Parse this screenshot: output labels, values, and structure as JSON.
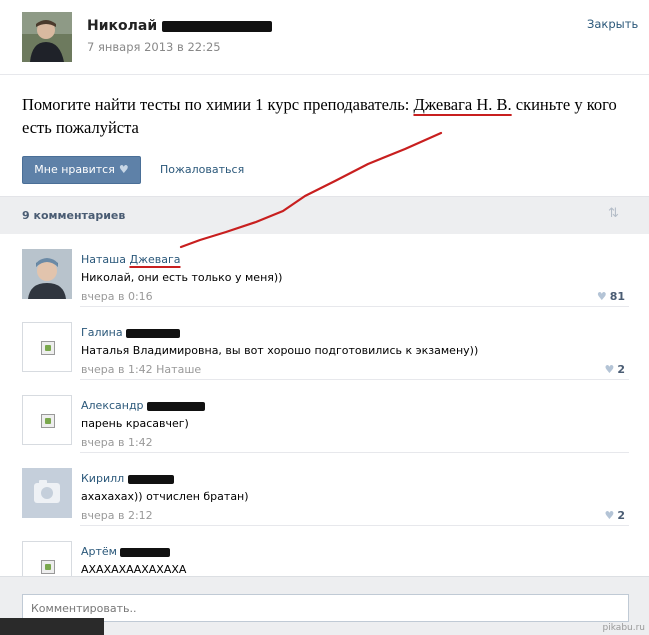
{
  "post": {
    "author_first_name": "Николай",
    "date": "7 января 2013 в 22:25",
    "close_label": "Закрыть",
    "text_before": "Помогите найти тесты по химии 1 курс преподаватель: ",
    "text_highlight": "Джевага Н. В.",
    "text_after": " скиньте у кого есть пожалуйста",
    "like_label": "Мне нравится",
    "report_label": "Пожаловаться"
  },
  "comments_header": {
    "count_label": "9 комментариев"
  },
  "comments": [
    {
      "first_name": "Наташа",
      "surname": "Джевага",
      "text": "Николай, они есть только у меня))",
      "time": "вчера в 0:16",
      "reply_to": "",
      "likes": "81"
    },
    {
      "first_name": "Галина",
      "surname": "",
      "text": "Наталья Владимировна, вы вот хорошо подготовились к экзамену))",
      "time": "вчера в 1:42",
      "reply_to": "Наташе",
      "likes": "2"
    },
    {
      "first_name": "Александр",
      "surname": "",
      "text": "парень красавчег)",
      "time": "вчера в 1:42",
      "reply_to": "",
      "likes": ""
    },
    {
      "first_name": "Кирилл",
      "surname": "",
      "text": "ахахахах)) отчислен братан)",
      "time": "вчера в 2:12",
      "reply_to": "",
      "likes": "2"
    },
    {
      "first_name": "Артём",
      "surname": "",
      "text": "АХАХАХААХАХАХА",
      "time": "",
      "reply_to": "",
      "likes": ""
    }
  ],
  "compose": {
    "placeholder": "Комментировать.."
  },
  "watermark": "pikabu.ru",
  "colors": {
    "link": "#2b587a",
    "like_button": "#5e81a8",
    "annotation_red": "#c81f1f",
    "bar_bg": "#edeef0"
  }
}
